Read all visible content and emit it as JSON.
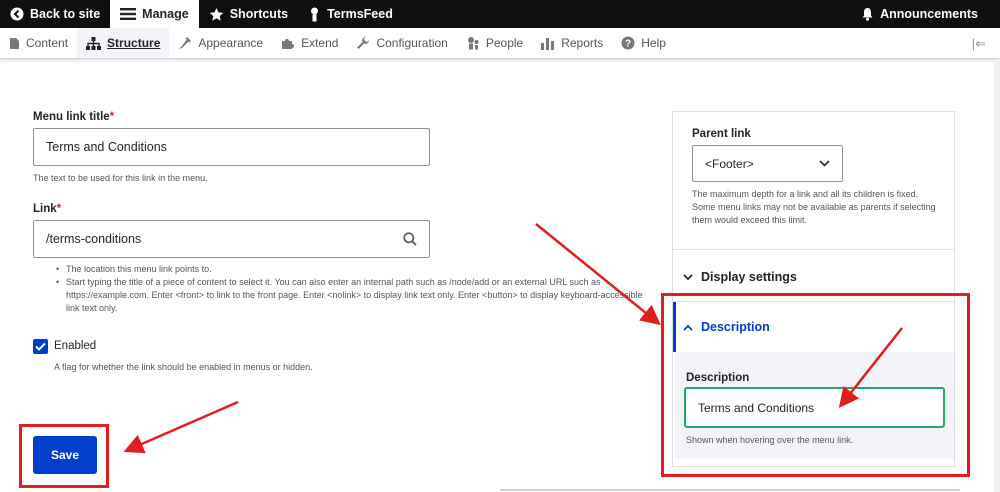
{
  "toolbar": {
    "back_label": "Back to site",
    "manage_label": "Manage",
    "shortcuts_label": "Shortcuts",
    "user_label": "TermsFeed",
    "announcements_label": "Announcements"
  },
  "tray": {
    "items": [
      {
        "label": "Content",
        "icon": "content-icon"
      },
      {
        "label": "Structure",
        "icon": "structure-icon",
        "active": true
      },
      {
        "label": "Appearance",
        "icon": "appearance-icon"
      },
      {
        "label": "Extend",
        "icon": "extend-icon"
      },
      {
        "label": "Configuration",
        "icon": "configuration-icon"
      },
      {
        "label": "People",
        "icon": "people-icon"
      },
      {
        "label": "Reports",
        "icon": "reports-icon"
      },
      {
        "label": "Help",
        "icon": "help-icon"
      }
    ],
    "toggle_glyph": "|⇐"
  },
  "form": {
    "title_label": "Menu link title",
    "required_mark": "*",
    "title_value": "Terms and Conditions",
    "title_desc": "The text to be used for this link in the menu.",
    "link_label": "Link",
    "link_value": "/terms-conditions",
    "link_help": [
      "The location this menu link points to.",
      "Start typing the title of a piece of content to select it. You can also enter an internal path such as /node/add or an external URL such as https://example.com. Enter <front> to link to the front page. Enter <nolink> to display link text only. Enter <button> to display keyboard-accessible link text only."
    ],
    "enabled_label": "Enabled",
    "enabled_checked": true,
    "enabled_desc": "A flag for whether the link should be enabled in menus or hidden.",
    "save_label": "Save"
  },
  "sidebar": {
    "parent_label": "Parent link",
    "parent_value": "<Footer>",
    "parent_desc": "The maximum depth for a link and all its children is fixed. Some menu links may not be available as parents if selecting them would exceed this limit.",
    "display_settings_label": "Display settings",
    "description_section_label": "Description",
    "description_field_label": "Description",
    "description_value": "Terms and Conditions",
    "description_help": "Shown when hovering over the menu link."
  },
  "colors": {
    "primary": "#003ecc",
    "annotation_red": "#e21d1d",
    "focus_green": "#26a769",
    "toolbar_bg": "#0f0f0f"
  }
}
